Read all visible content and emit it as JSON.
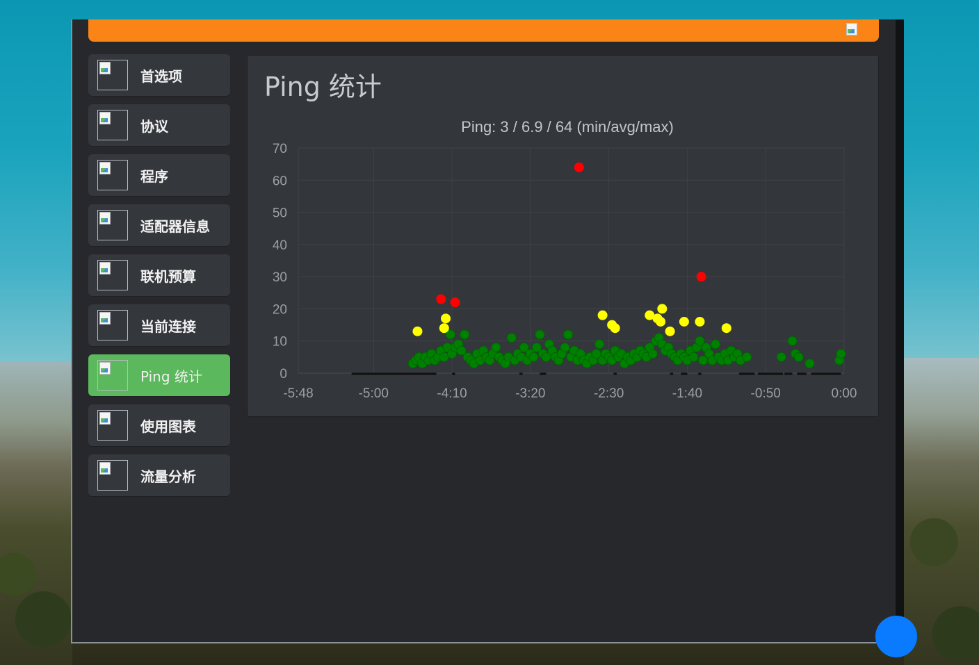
{
  "nav": {
    "items": [
      {
        "label": "首选项",
        "icon": "preferences-icon"
      },
      {
        "label": "协议",
        "icon": "protocol-icon"
      },
      {
        "label": "程序",
        "icon": "program-icon"
      },
      {
        "label": "适配器信息",
        "icon": "adapter-info-icon"
      },
      {
        "label": "联机预算",
        "icon": "online-budget-icon"
      },
      {
        "label": "当前连接",
        "icon": "current-connection-icon"
      },
      {
        "label": "Ping 统计",
        "icon": "ping-stats-icon",
        "active": true
      },
      {
        "label": "使用图表",
        "icon": "usage-chart-icon"
      },
      {
        "label": "流量分析",
        "icon": "traffic-analysis-icon"
      }
    ]
  },
  "panel": {
    "title": "Ping 统计"
  },
  "colors": {
    "topbar": "#fb8417",
    "active_nav": "#5cb85c",
    "ping_good": "#008000",
    "ping_medium": "#ffff00",
    "ping_bad": "#ff0000",
    "timeout_line": "#111111"
  },
  "chart_data": {
    "type": "scatter",
    "title": "Ping: 3 / 6.9 / 64 (min/avg/max)",
    "xlabel": "",
    "ylabel": "",
    "xlim": [
      -348,
      0
    ],
    "ylim": [
      0,
      70
    ],
    "xticks": [
      -348,
      -300,
      -250,
      -200,
      -150,
      -100,
      -50,
      0
    ],
    "xtick_labels": [
      "-5:48",
      "-5:00",
      "-4:10",
      "-3:20",
      "-2:30",
      "-1:40",
      "-0:50",
      "0:00"
    ],
    "yticks": [
      0,
      10,
      20,
      30,
      40,
      50,
      60,
      70
    ],
    "grid": true,
    "timeouts": [
      [
        -314,
        -260
      ],
      [
        -250,
        -248
      ],
      [
        -207,
        -205
      ],
      [
        -194,
        -190
      ],
      [
        -147,
        -145
      ],
      [
        -111,
        -109
      ],
      [
        -104,
        -100
      ],
      [
        -93,
        -91
      ],
      [
        -67,
        -57
      ],
      [
        -55,
        -39
      ],
      [
        -38,
        -33
      ],
      [
        -30,
        -24
      ],
      [
        -21,
        -2
      ]
    ],
    "series": [
      {
        "color": "#ff0000",
        "points": [
          [
            -257,
            23
          ],
          [
            -248,
            22
          ],
          [
            -169,
            64
          ],
          [
            -91,
            30
          ]
        ]
      },
      {
        "color": "#ffff00",
        "points": [
          [
            -272,
            13
          ],
          [
            -255,
            14
          ],
          [
            -254,
            17
          ],
          [
            -154,
            18
          ],
          [
            -148,
            15
          ],
          [
            -146,
            14
          ],
          [
            -124,
            18
          ],
          [
            -119,
            17
          ],
          [
            -117,
            16
          ],
          [
            -116,
            20
          ],
          [
            -111,
            13
          ],
          [
            -102,
            16
          ],
          [
            -92,
            16
          ],
          [
            -75,
            14
          ]
        ]
      },
      {
        "color": "#008000",
        "points": [
          [
            -275,
            3
          ],
          [
            -273,
            4
          ],
          [
            -271,
            5
          ],
          [
            -269,
            3
          ],
          [
            -267,
            5
          ],
          [
            -265,
            4
          ],
          [
            -263,
            6
          ],
          [
            -261,
            4
          ],
          [
            -259,
            5
          ],
          [
            -257,
            7
          ],
          [
            -255,
            5
          ],
          [
            -253,
            8
          ],
          [
            -251,
            12
          ],
          [
            -250,
            6
          ],
          [
            -248,
            8
          ],
          [
            -246,
            9
          ],
          [
            -244,
            7
          ],
          [
            -242,
            12
          ],
          [
            -240,
            5
          ],
          [
            -238,
            4
          ],
          [
            -236,
            3
          ],
          [
            -234,
            6
          ],
          [
            -232,
            4
          ],
          [
            -230,
            7
          ],
          [
            -228,
            5
          ],
          [
            -226,
            4
          ],
          [
            -224,
            6
          ],
          [
            -222,
            8
          ],
          [
            -220,
            5
          ],
          [
            -218,
            4
          ],
          [
            -216,
            3
          ],
          [
            -214,
            5
          ],
          [
            -212,
            11
          ],
          [
            -210,
            4
          ],
          [
            -208,
            6
          ],
          [
            -206,
            5
          ],
          [
            -204,
            8
          ],
          [
            -202,
            4
          ],
          [
            -200,
            6
          ],
          [
            -198,
            5
          ],
          [
            -196,
            8
          ],
          [
            -194,
            12
          ],
          [
            -192,
            6
          ],
          [
            -190,
            5
          ],
          [
            -188,
            9
          ],
          [
            -186,
            7
          ],
          [
            -184,
            5
          ],
          [
            -182,
            4
          ],
          [
            -180,
            6
          ],
          [
            -178,
            8
          ],
          [
            -176,
            12
          ],
          [
            -174,
            5
          ],
          [
            -172,
            7
          ],
          [
            -170,
            4
          ],
          [
            -168,
            6
          ],
          [
            -166,
            4
          ],
          [
            -164,
            3
          ],
          [
            -162,
            5
          ],
          [
            -160,
            4
          ],
          [
            -158,
            6
          ],
          [
            -156,
            9
          ],
          [
            -154,
            4
          ],
          [
            -152,
            6
          ],
          [
            -150,
            5
          ],
          [
            -148,
            4
          ],
          [
            -146,
            7
          ],
          [
            -144,
            5
          ],
          [
            -142,
            6
          ],
          [
            -140,
            3
          ],
          [
            -138,
            5
          ],
          [
            -136,
            4
          ],
          [
            -134,
            6
          ],
          [
            -132,
            5
          ],
          [
            -130,
            7
          ],
          [
            -128,
            6
          ],
          [
            -126,
            5
          ],
          [
            -124,
            8
          ],
          [
            -122,
            6
          ],
          [
            -120,
            10
          ],
          [
            -118,
            11
          ],
          [
            -116,
            9
          ],
          [
            -114,
            7
          ],
          [
            -112,
            8
          ],
          [
            -110,
            6
          ],
          [
            -108,
            5
          ],
          [
            -106,
            4
          ],
          [
            -104,
            6
          ],
          [
            -102,
            5
          ],
          [
            -100,
            4
          ],
          [
            -98,
            7
          ],
          [
            -96,
            5
          ],
          [
            -94,
            8
          ],
          [
            -92,
            10
          ],
          [
            -90,
            4
          ],
          [
            -88,
            8
          ],
          [
            -86,
            6
          ],
          [
            -84,
            4
          ],
          [
            -82,
            9
          ],
          [
            -80,
            5
          ],
          [
            -78,
            4
          ],
          [
            -76,
            6
          ],
          [
            -74,
            4
          ],
          [
            -72,
            7
          ],
          [
            -70,
            5
          ],
          [
            -68,
            6
          ],
          [
            -66,
            4
          ],
          [
            -62,
            5
          ],
          [
            -40,
            5
          ],
          [
            -33,
            10
          ],
          [
            -31,
            6
          ],
          [
            -29,
            5
          ],
          [
            -22,
            3
          ],
          [
            -3,
            4
          ],
          [
            -2,
            6
          ]
        ]
      }
    ]
  }
}
